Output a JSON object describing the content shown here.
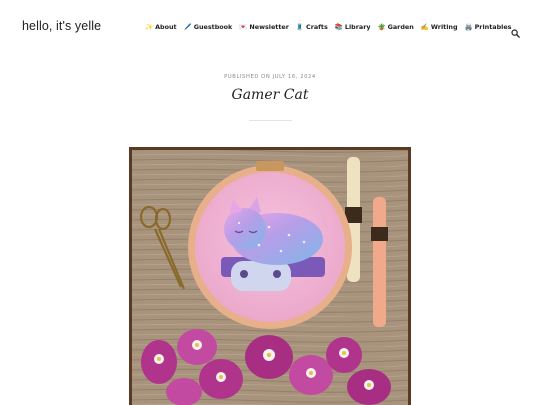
{
  "site": {
    "title": "hello, it's yelle"
  },
  "nav": {
    "items": [
      {
        "emoji": "✨",
        "label": "About"
      },
      {
        "emoji": "🖊️",
        "label": "Guestbook"
      },
      {
        "emoji": "💌",
        "label": "Newsletter"
      },
      {
        "emoji": "🧵",
        "label": "Crafts"
      },
      {
        "emoji": "📚",
        "label": "Library"
      },
      {
        "emoji": "🪴",
        "label": "Garden"
      },
      {
        "emoji": "✍️",
        "label": "Writing"
      },
      {
        "emoji": "🖨️",
        "label": "Printables"
      }
    ],
    "search_icon": "search-icon"
  },
  "post": {
    "meta": "PUBLISHED ON JULY 16, 2024",
    "title": "Gamer Cat"
  },
  "colors": {
    "wood": "#a8937d",
    "fabric": "#f2b6d6",
    "hoop": "#e7b08a",
    "orchid": "#b0338c",
    "frame": "#5a3a22"
  }
}
